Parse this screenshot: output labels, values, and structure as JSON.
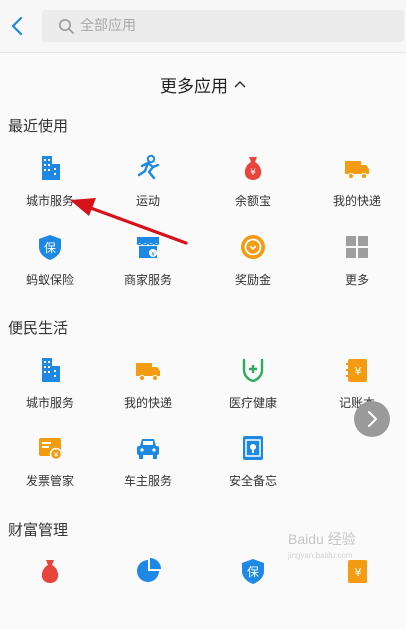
{
  "search": {
    "placeholder": "全部应用"
  },
  "more_apps": {
    "label": "更多应用"
  },
  "sections": {
    "recent": {
      "title": "最近使用",
      "apps": [
        "城市服务",
        "运动",
        "余额宝",
        "我的快递",
        "蚂蚁保险",
        "商家服务",
        "奖励金",
        "更多"
      ]
    },
    "convenience": {
      "title": "便民生活",
      "apps": [
        "城市服务",
        "我的快递",
        "医疗健康",
        "记账本",
        "发票管家",
        "车主服务",
        "安全备忘"
      ]
    },
    "wealth": {
      "title": "财富管理"
    }
  },
  "watermark": {
    "text": "Baidu 经验",
    "sub": "jingyan.baidu.com"
  },
  "colors": {
    "blue": "#1e88e5",
    "orange": "#f39c12",
    "red": "#e8453c",
    "green": "#2eaa5c",
    "gray": "#9e9e9e",
    "arrow": "#d6121b"
  }
}
